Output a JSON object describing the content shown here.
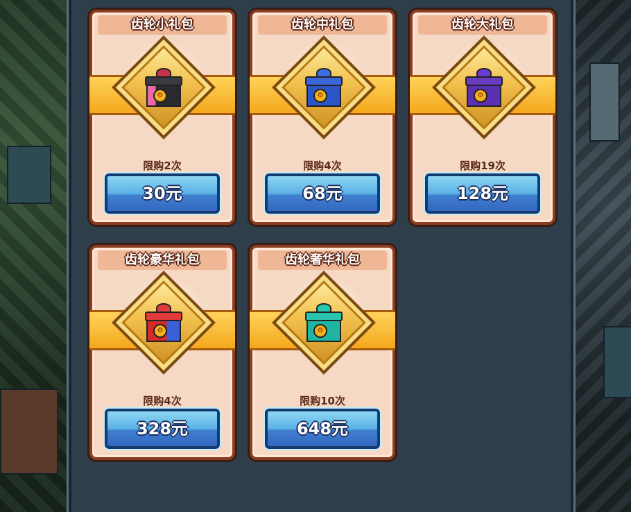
{
  "packs": [
    {
      "title": "齿轮小礼包",
      "limit": "限购2次",
      "price": "30元",
      "gift_color": "#2a2a2e",
      "accent": "#e86aa8"
    },
    {
      "title": "齿轮中礼包",
      "limit": "限购4次",
      "price": "68元",
      "gift_color": "#2c56c8",
      "accent": "#f1d34a"
    },
    {
      "title": "齿轮大礼包",
      "limit": "限购19次",
      "price": "128元",
      "gift_color": "#5a2fb0",
      "accent": "#f1d34a"
    },
    {
      "title": "齿轮豪华礼包",
      "limit": "限购4次",
      "price": "328元",
      "gift_color": "#d42a2a",
      "accent": "#3b5fd6"
    },
    {
      "title": "齿轮奢华礼包",
      "limit": "限购10次",
      "price": "648元",
      "gift_color": "#1fb5a0",
      "accent": "#f1d34a"
    }
  ],
  "colors": {
    "panel_bg": "#2f3e4b",
    "card_bg": "#f6d9c4",
    "button_blue": "#3f7fd0",
    "ribbon_gold": "#f4a81c"
  }
}
